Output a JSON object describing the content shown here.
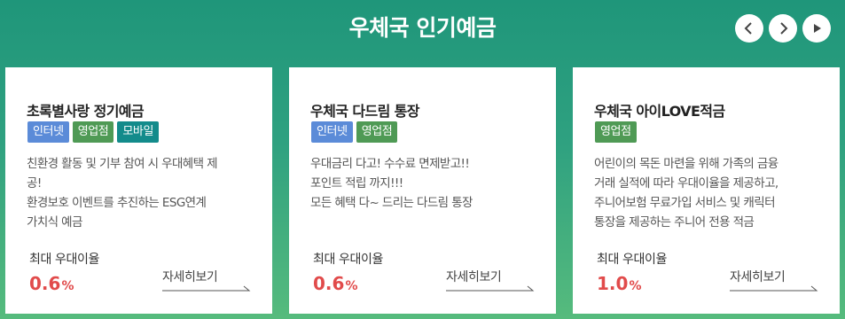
{
  "title": "우체국 인기예금",
  "nav": {
    "prev": "chevron-left-icon",
    "next": "chevron-right-icon",
    "play": "play-icon"
  },
  "cards": [
    {
      "title": "초록별사랑 정기예금",
      "badges": [
        "인터넷",
        "영업점",
        "모바일"
      ],
      "desc": [
        "친환경 활동 및 기부 참여 시 우대혜택 제",
        "공!",
        "환경보호 이벤트를 추진하는 ESG연계",
        "가치식 예금"
      ],
      "rate_label": "최대 우대이율",
      "rate_value": "0.6",
      "rate_unit": "%",
      "more_label": "자세히보기"
    },
    {
      "title": "우체국 다드림 통장",
      "badges": [
        "인터넷",
        "영업점"
      ],
      "desc": [
        "우대금리 다고! 수수료 면제받고!!",
        "포인트 적립 까지!!!",
        "모든 혜택 다~ 드리는 다드림 통장"
      ],
      "rate_label": "최대 우대이율",
      "rate_value": "0.6",
      "rate_unit": "%",
      "more_label": "자세히보기"
    },
    {
      "title": "우체국 아이LOVE적금",
      "badges": [
        "영업점"
      ],
      "desc": [
        "어린이의 목돈 마련을 위해 가족의 금융",
        "거래 실적에 따라 우대이율을 제공하고,",
        "주니어보험 무료가입 서비스 및 캐릭터",
        "통장을 제공하는 주니어 전용 적금"
      ],
      "rate_label": "최대 우대이율",
      "rate_value": "1.0",
      "rate_unit": "%",
      "more_label": "자세히보기"
    }
  ],
  "colors": {
    "accent": "#1f967a",
    "rate": "#e14b4b",
    "internet": "#5b8bd8",
    "branch": "#4f9a55",
    "mobile": "#138b8b"
  }
}
